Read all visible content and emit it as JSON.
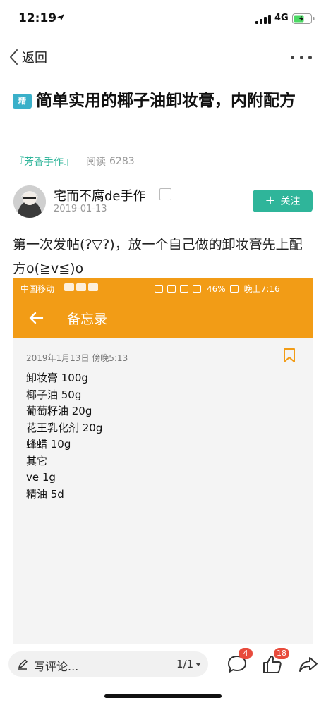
{
  "status_bar": {
    "time": "12:19",
    "network": "4G"
  },
  "nav": {
    "back_label": "返回"
  },
  "post": {
    "badge": "精",
    "title": "简单实用的椰子油卸妆膏，内附配方",
    "circle": "『芳香手作』",
    "read_label": "阅读",
    "read_count": "6283",
    "author": "宅而不腐de手作",
    "date": "2019-01-13",
    "follow_label": "关注",
    "body": "第一次发帖(?▽?)，放一个自己做的卸妆膏先上配方o(≧v≦)o"
  },
  "screenshot": {
    "carrier": "中国移动",
    "battery": "46%",
    "time": "晚上7:16",
    "app_title": "备忘录",
    "datetime": "2019年1月13日 傍晚5:13",
    "lines": [
      "卸妆膏 100g",
      "椰子油 50g",
      "葡萄籽油 20g",
      "花王乳化剂 20g",
      "蜂蜡 10g",
      "其它",
      "ve 1g",
      "精油 5d"
    ]
  },
  "bottom_bar": {
    "comment_placeholder": "写评论...",
    "page_indicator": "1/1",
    "comment_count": "4",
    "like_count": "18"
  },
  "colors": {
    "accent": "#2fb59a",
    "memo_orange": "#f29c16",
    "badge_red": "#e84b3c"
  },
  "icons": [
    "location-arrow-icon",
    "signal-icon",
    "battery-icon",
    "back-chevron-icon",
    "more-icon",
    "pencil-icon",
    "comment-icon",
    "thumbs-up-icon",
    "share-icon",
    "bookmark-icon"
  ]
}
